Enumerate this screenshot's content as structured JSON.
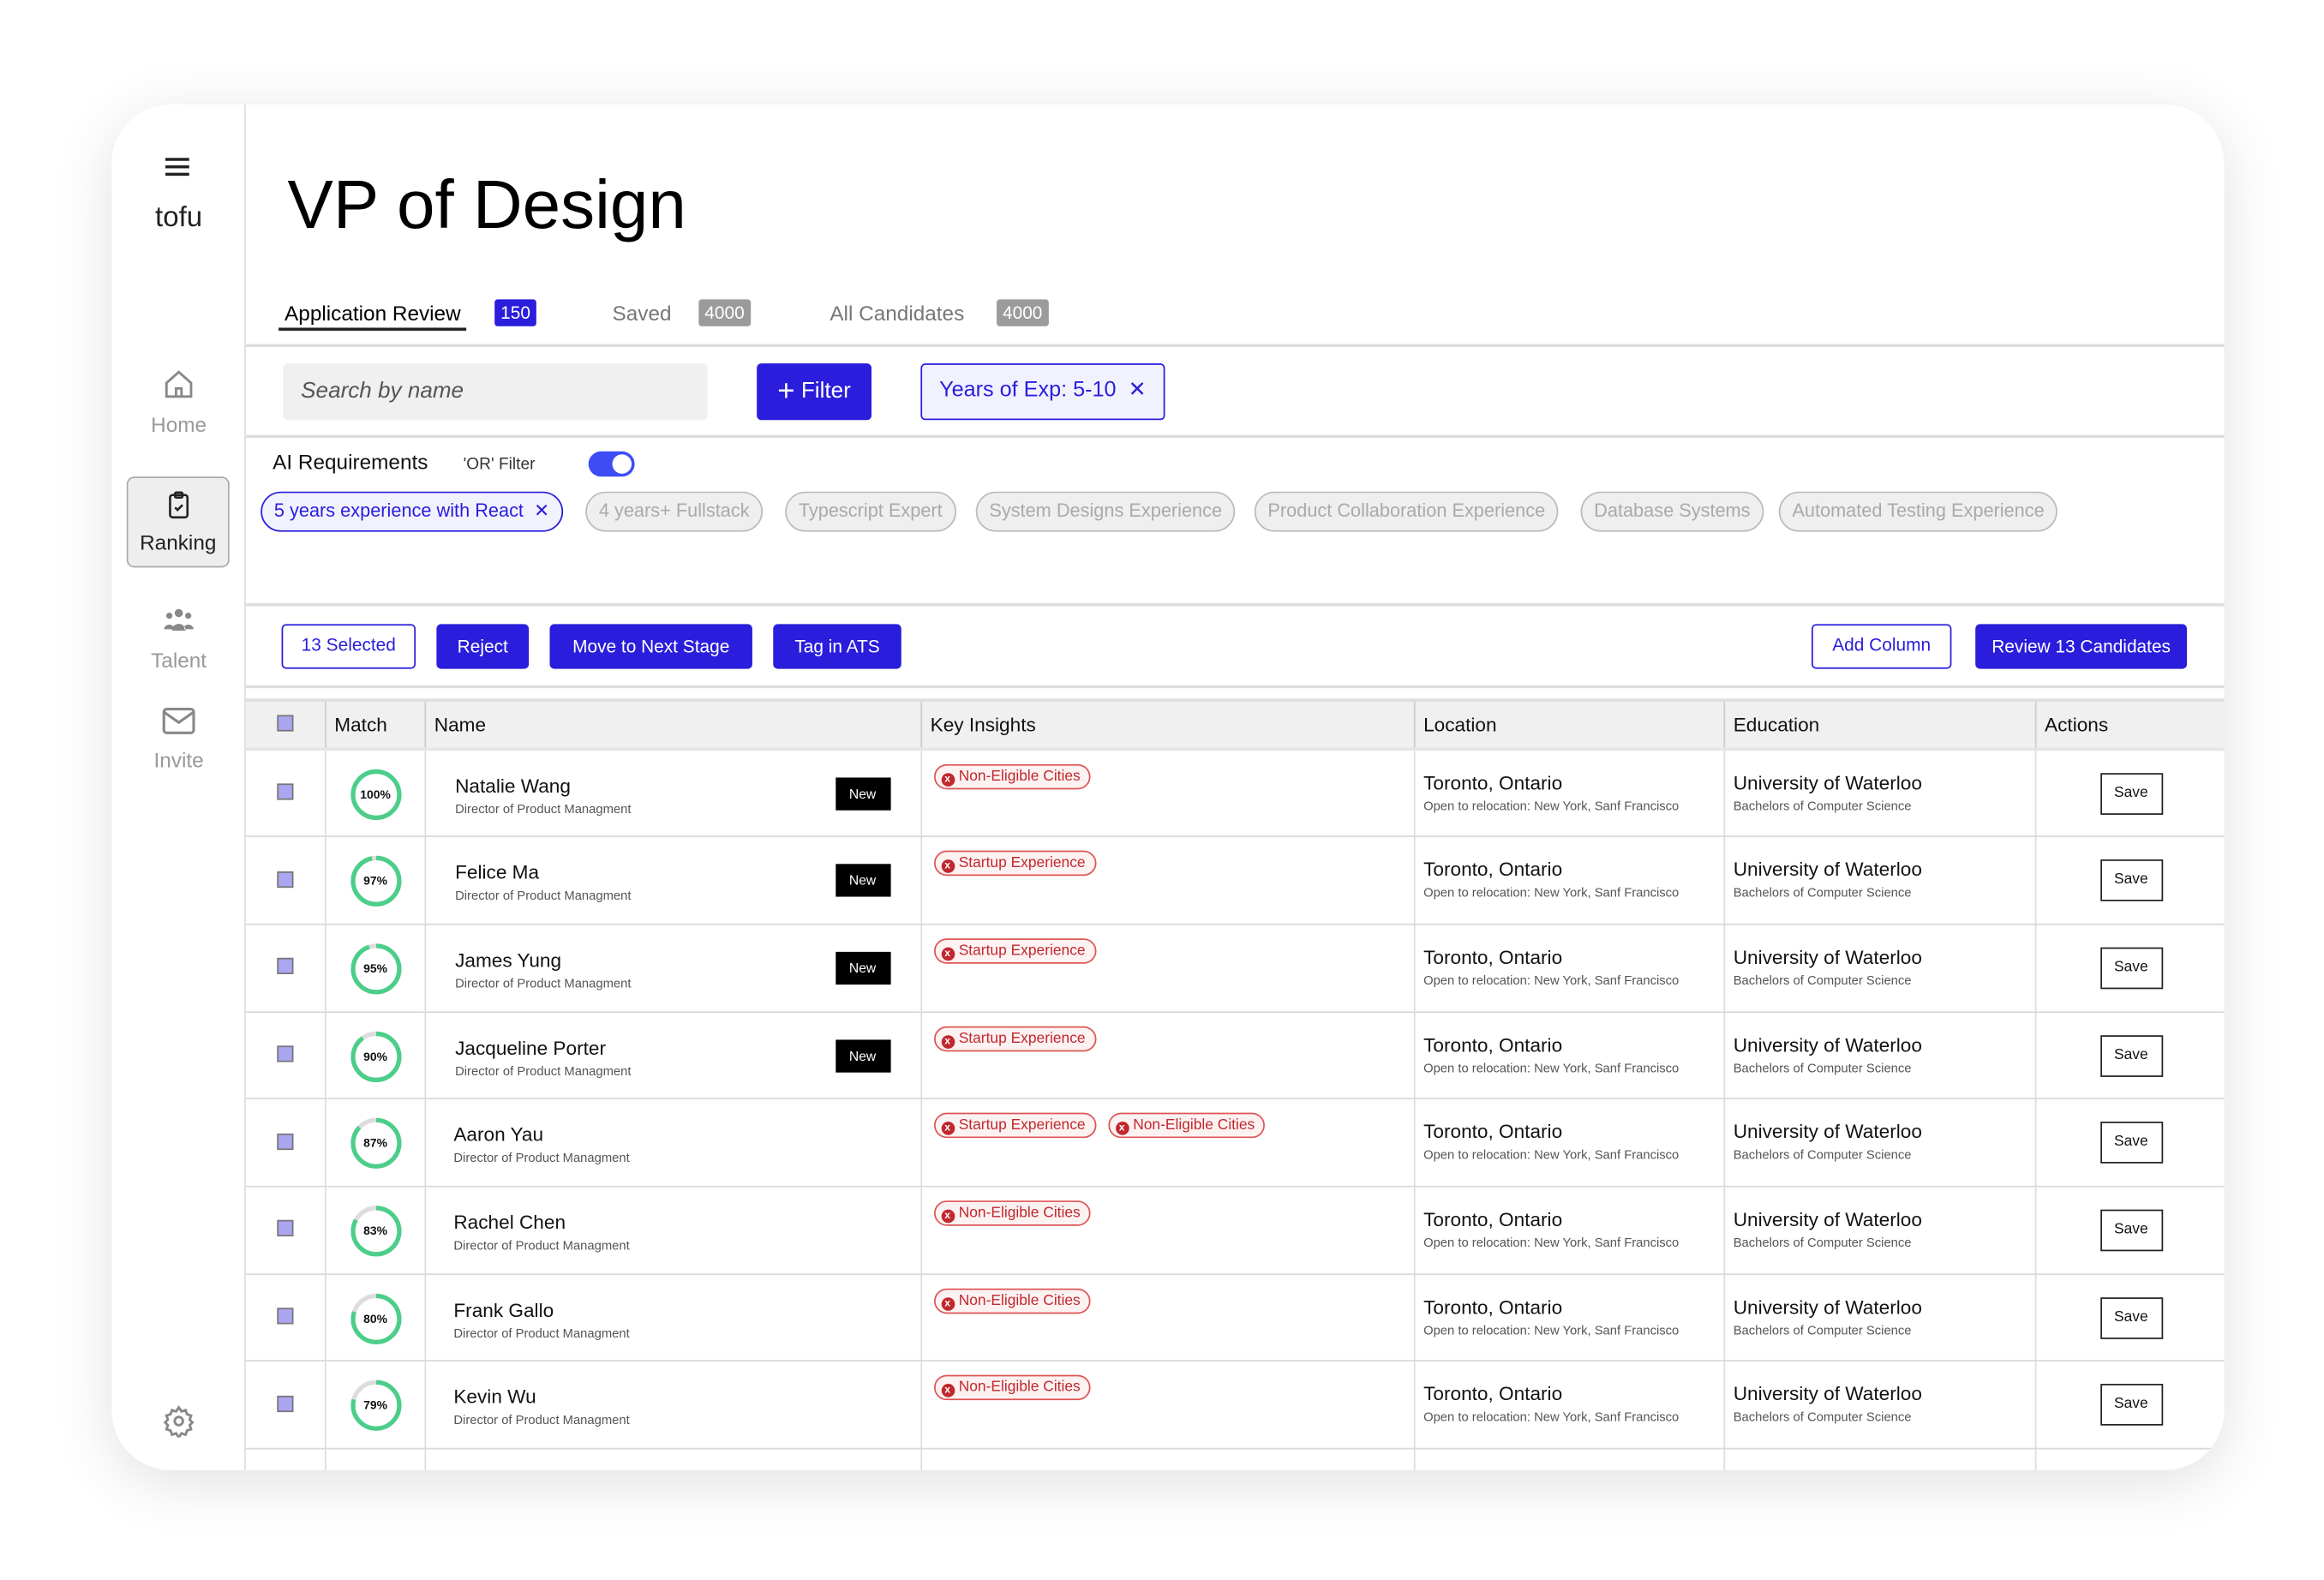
{
  "brand": "tofu",
  "sidebar": {
    "items": [
      {
        "label": "Home",
        "icon": "home-icon"
      },
      {
        "label": "Ranking",
        "icon": "clipboard-check-icon"
      },
      {
        "label": "Talent",
        "icon": "people-icon"
      },
      {
        "label": "Invite",
        "icon": "mail-icon"
      }
    ],
    "settings_icon": "gear-icon"
  },
  "title": "VP of Design",
  "tabs": [
    {
      "label": "Application Review",
      "count": "150"
    },
    {
      "label": "Saved",
      "count": "4000"
    },
    {
      "label": "All Candidates",
      "count": "4000"
    }
  ],
  "search": {
    "placeholder": "Search by name"
  },
  "filter_label": "Filter",
  "active_filter": "Years of Exp: 5-10",
  "ai": {
    "label": "AI Requirements",
    "or_filter": "'OR' Filter",
    "or_filter_on": true,
    "chips": [
      {
        "label": "5 years experience with React",
        "active": true
      },
      {
        "label": "4 years+  Fullstack"
      },
      {
        "label": "Typescript Expert"
      },
      {
        "label": "System Designs Experience"
      },
      {
        "label": "Product Collaboration Experience"
      },
      {
        "label": "Database Systems"
      },
      {
        "label": "Automated Testing Experience"
      }
    ]
  },
  "actions": {
    "selected": "13 Selected",
    "reject": "Reject",
    "next": "Move to Next Stage",
    "tag": "Tag in ATS",
    "add_column": "Add Column",
    "review": "Review 13 Candidates"
  },
  "columns": [
    "Match",
    "Name",
    "Key Insights",
    "Location",
    "Education",
    "Actions"
  ],
  "colors": {
    "primary": "#2a1ddb",
    "match": "#4cce8a",
    "insight": "#c0282d"
  },
  "rows": [
    {
      "match": 100,
      "match_label": "100%",
      "name": "Natalie Wang",
      "title": "Director of Product Managment",
      "new": "New",
      "insights": [
        "Non-Eligible Cities"
      ],
      "city": "Toronto, Ontario",
      "relocation": "Open to relocation: New York, Sanf Francisco",
      "school": "University of Waterloo",
      "degree": "Bachelors of Computer Science",
      "save": "Save"
    },
    {
      "match": 97,
      "match_label": "97%",
      "name": "Felice Ma",
      "title": "Director of Product Managment",
      "new": "New",
      "insights": [
        "Startup Experience"
      ],
      "city": "Toronto, Ontario",
      "relocation": "Open to relocation: New York, Sanf Francisco",
      "school": "University of Waterloo",
      "degree": "Bachelors of Computer Science",
      "save": "Save"
    },
    {
      "match": 95,
      "match_label": "95%",
      "name": "James Yung",
      "title": "Director of Product Managment",
      "new": "New",
      "insights": [
        "Startup Experience"
      ],
      "city": "Toronto, Ontario",
      "relocation": "Open to relocation: New York, Sanf Francisco",
      "school": "University of Waterloo",
      "degree": "Bachelors of Computer Science",
      "save": "Save"
    },
    {
      "match": 90,
      "match_label": "90%",
      "name": "Jacqueline Porter",
      "title": "Director of Product Managment",
      "new": "New",
      "insights": [
        "Startup Experience"
      ],
      "city": "Toronto, Ontario",
      "relocation": "Open to relocation: New York, Sanf Francisco",
      "school": "University of Waterloo",
      "degree": "Bachelors of Computer Science",
      "save": "Save"
    },
    {
      "match": 87,
      "match_label": "87%",
      "name": "Aaron Yau",
      "title": "Director of Product Managment",
      "insights": [
        "Startup Experience",
        "Non-Eligible Cities"
      ],
      "city": "Toronto, Ontario",
      "relocation": "Open to relocation: New York, Sanf Francisco",
      "school": "University of Waterloo",
      "degree": "Bachelors of Computer Science",
      "save": "Save"
    },
    {
      "match": 83,
      "match_label": "83%",
      "name": "Rachel Chen",
      "title": "Director of Product Managment",
      "insights": [
        "Non-Eligible Cities"
      ],
      "city": "Toronto, Ontario",
      "relocation": "Open to relocation: New York, Sanf Francisco",
      "school": "University of Waterloo",
      "degree": "Bachelors of Computer Science",
      "save": "Save"
    },
    {
      "match": 80,
      "match_label": "80%",
      "name": "Frank Gallo",
      "title": "Director of Product Managment",
      "insights": [
        "Non-Eligible Cities"
      ],
      "city": "Toronto, Ontario",
      "relocation": "Open to relocation: New York, Sanf Francisco",
      "school": "University of Waterloo",
      "degree": "Bachelors of Computer Science",
      "save": "Save"
    },
    {
      "match": 79,
      "match_label": "79%",
      "name": "Kevin Wu",
      "title": "Director of Product Managment",
      "insights": [
        "Non-Eligible Cities"
      ],
      "city": "Toronto, Ontario",
      "relocation": "Open to relocation: New York, Sanf Francisco",
      "school": "University of Waterloo",
      "degree": "Bachelors of Computer Science",
      "save": "Save"
    }
  ]
}
